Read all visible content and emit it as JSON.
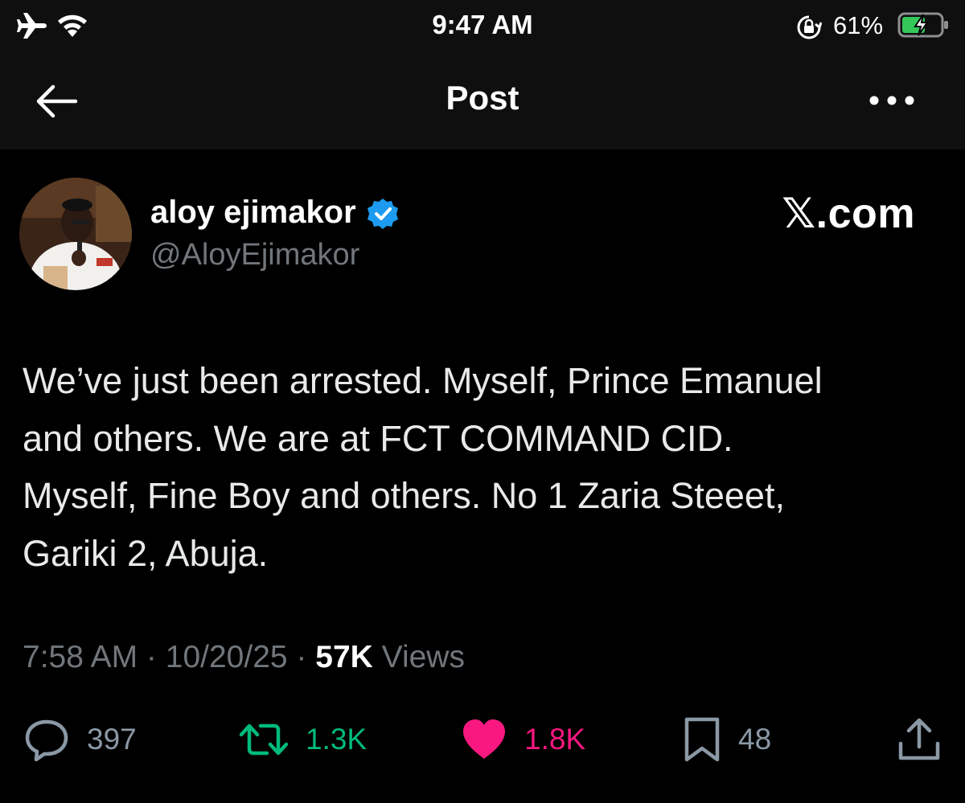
{
  "status_bar": {
    "time": "9:47 AM",
    "battery_percent": "61%",
    "battery_level": 0.61,
    "icons": [
      "airplane-icon",
      "wifi-icon",
      "lock-rotation-icon",
      "battery-charging-icon"
    ]
  },
  "header": {
    "title": "Post",
    "back_icon": "arrow-left-icon",
    "more_icon": "more-horizontal-icon"
  },
  "author": {
    "name": "aloy ejimakor",
    "handle": "@AloyEjimakor",
    "verified": true,
    "badge_color": "#1d9bf0"
  },
  "watermark": "𝕏.com",
  "post": {
    "text": "We’ve just been arrested. Myself, Prince Emanuel\nand others. We are at FCT COMMAND CID.\nMyself, Fine Boy and others. No 1 Zaria Steeet,\nGariki 2, Abuja.",
    "time": "7:58 AM",
    "date": "10/20/25",
    "separator": " · ",
    "views": "57K",
    "views_label": " Views"
  },
  "actions": {
    "reply_count": "397",
    "repost_count": "1.3K",
    "like_count": "1.8K",
    "bookmark_count": "48",
    "colors": {
      "repost": "#00ba7c",
      "like": "#f91880",
      "muted": "#8b98a5"
    }
  }
}
